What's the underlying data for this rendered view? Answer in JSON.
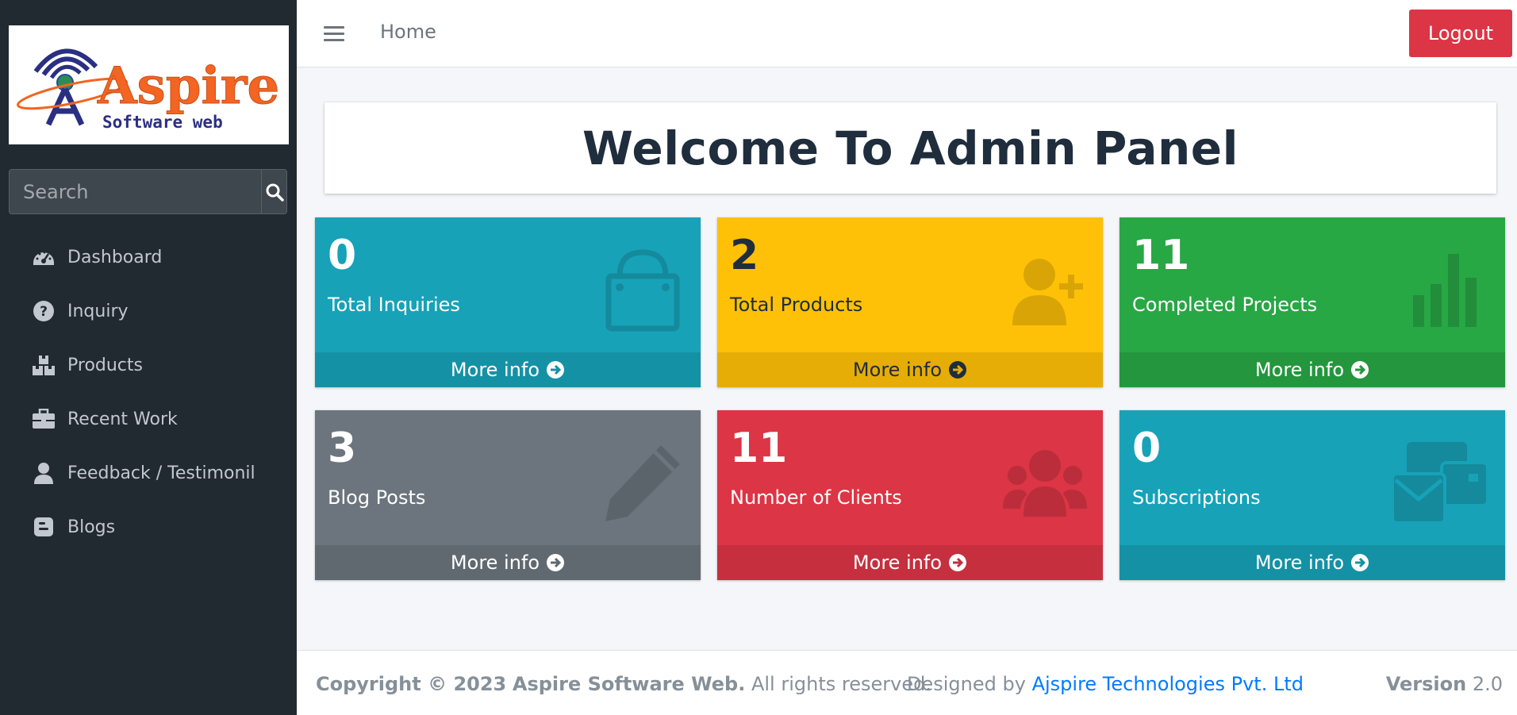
{
  "sidebar": {
    "logo": {
      "main": "Aspire",
      "sub": "Software web"
    },
    "search": {
      "placeholder": "Search"
    },
    "items": [
      {
        "label": "Dashboard",
        "icon": "tachometer-icon"
      },
      {
        "label": "Inquiry",
        "icon": "question-circle-icon"
      },
      {
        "label": "Products",
        "icon": "boxes-icon"
      },
      {
        "label": "Recent Work",
        "icon": "briefcase-icon"
      },
      {
        "label": "Feedback / Testimonil",
        "icon": "user-icon"
      },
      {
        "label": "Blogs",
        "icon": "blogger-icon"
      }
    ]
  },
  "topbar": {
    "home_label": "Home",
    "logout_label": "Logout"
  },
  "main": {
    "title": "Welcome To Admin Panel",
    "more_info_label": "More info",
    "boxes": [
      {
        "count": "0",
        "label": "Total Inquiries",
        "icon": "shopping-bag-icon",
        "color": "#17a2b8"
      },
      {
        "count": "2",
        "label": "Total Products",
        "icon": "user-plus-icon",
        "color": "#ffc107"
      },
      {
        "count": "11",
        "label": "Completed Projects",
        "icon": "bar-chart-icon",
        "color": "#28a745"
      },
      {
        "count": "3",
        "label": "Blog Posts",
        "icon": "pencil-icon",
        "color": "#6c757d"
      },
      {
        "count": "11",
        "label": "Number of Clients",
        "icon": "users-icon",
        "color": "#dc3545"
      },
      {
        "count": "0",
        "label": "Subscriptions",
        "icon": "envelopes-icon",
        "color": "#17a2b8"
      }
    ]
  },
  "footer": {
    "copyright_prefix": "Copyright © 2023",
    "brand": "Aspire Software Web.",
    "rights": "All rights reserved.",
    "designed_prefix": "Designed by",
    "designer": "Ajspire Technologies Pvt. Ltd",
    "version_label": "Version",
    "version_value": "2.0"
  }
}
